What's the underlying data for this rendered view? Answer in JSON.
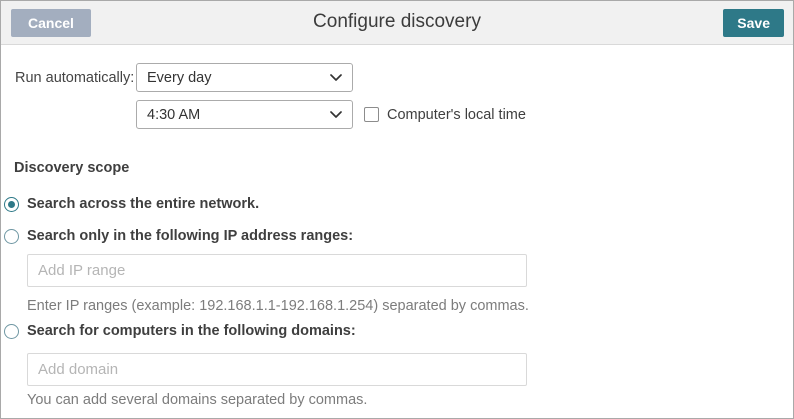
{
  "header": {
    "title": "Configure discovery",
    "cancel_label": "Cancel",
    "save_label": "Save"
  },
  "schedule": {
    "label": "Run automatically:",
    "frequency_value": "Every day",
    "time_value": "4:30 AM",
    "local_time_label": "Computer's local time",
    "local_time_checked": false
  },
  "scope": {
    "heading": "Discovery scope",
    "options": [
      {
        "label": "Search across the entire network.",
        "selected": true
      },
      {
        "label": "Search only in the following IP address ranges:",
        "selected": false,
        "placeholder": "Add IP range",
        "helper": "Enter IP ranges (example: 192.168.1.1-192.168.1.254) separated by commas."
      },
      {
        "label": "Search for computers in the following domains:",
        "selected": false,
        "placeholder": "Add domain",
        "helper": "You can add several domains separated by commas."
      }
    ]
  },
  "colors": {
    "accent": "#2e7988",
    "cancel_button": "#a3aebf",
    "header_background": "#f1f1f1"
  }
}
